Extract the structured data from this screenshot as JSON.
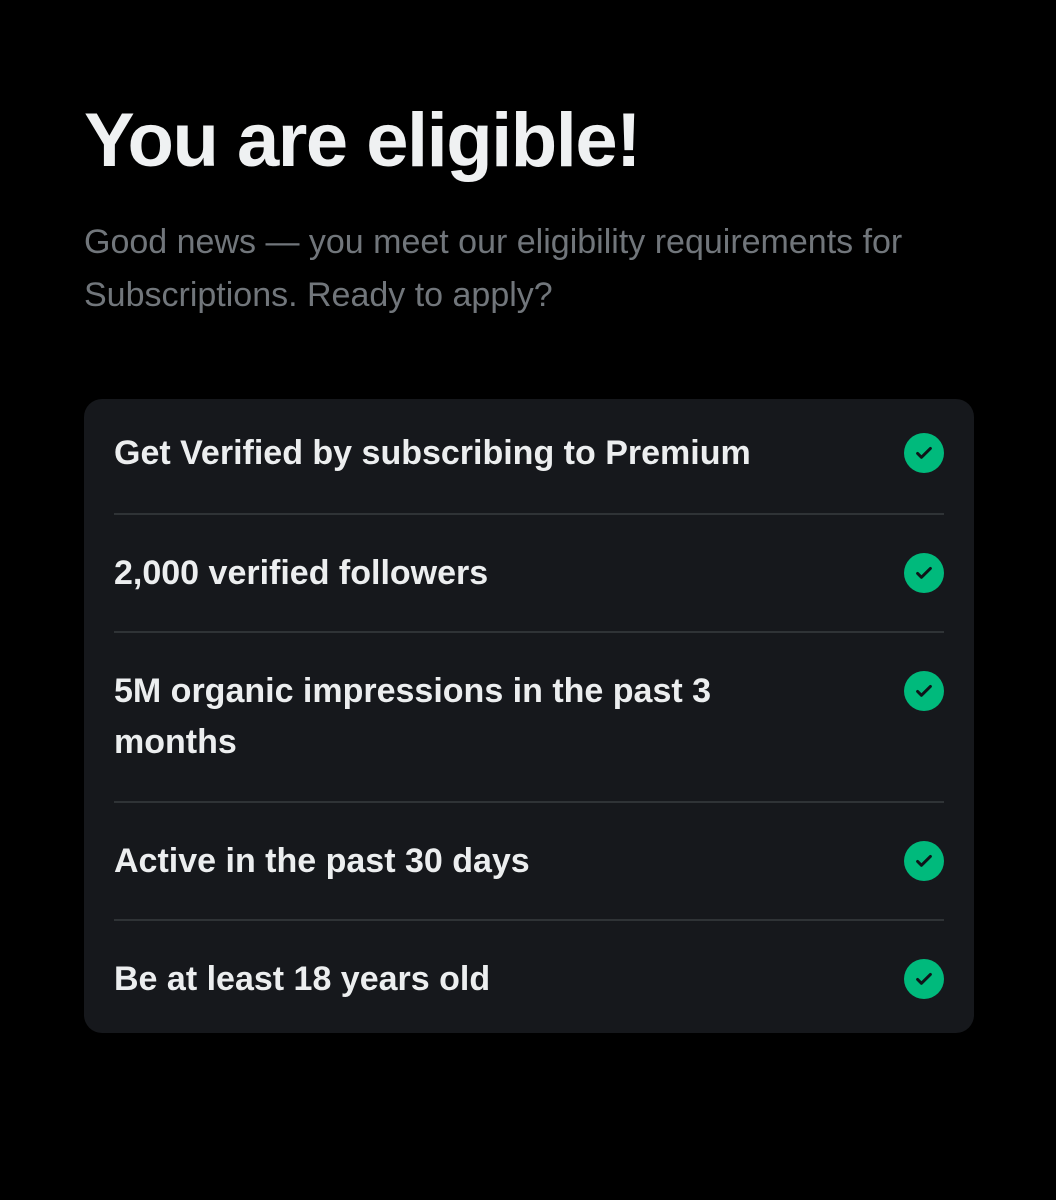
{
  "header": {
    "title": "You are eligible!",
    "subtitle": "Good news — you meet our eligibility requirements for Subscriptions. Ready to apply?"
  },
  "requirements": [
    {
      "label": "Get Verified by subscribing to Premium",
      "status": "met"
    },
    {
      "label": "2,000 verified followers",
      "status": "met"
    },
    {
      "label": "5M organic impressions in the past 3 months",
      "status": "met"
    },
    {
      "label": "Active in the past 30 days",
      "status": "met"
    },
    {
      "label": "Be at least 18 years old",
      "status": "met"
    }
  ],
  "colors": {
    "background": "#000000",
    "card": "#16181c",
    "divider": "#2f3336",
    "check": "#00ba7c",
    "subtitle": "#71767b"
  },
  "icons": {
    "status_met": "check-circle-icon"
  }
}
